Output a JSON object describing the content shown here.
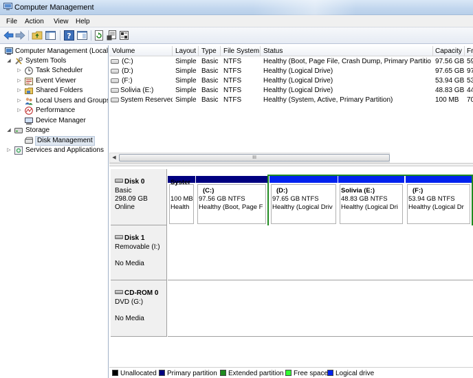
{
  "window": {
    "title": "Computer Management"
  },
  "menu": [
    "File",
    "Action",
    "View",
    "Help"
  ],
  "toolbar": {
    "buttons": [
      "back-arrow-icon",
      "forward-arrow-icon",
      "up-folder-icon",
      "show-hide-console-tree-icon",
      "help-icon",
      "properties-icon",
      "refresh-icon",
      "export-list-icon",
      "settings-icon"
    ]
  },
  "tree": [
    {
      "label": "Computer Management (Local",
      "name": "tree-computer-management",
      "icon": "computer-icon",
      "exp": "",
      "selected": false
    },
    {
      "label": "System Tools",
      "name": "tree-system-tools",
      "icon": "tools-icon",
      "exp": "◢",
      "selected": false
    },
    {
      "label": "Task Scheduler",
      "name": "tree-task-scheduler",
      "icon": "clock-icon",
      "exp": "▷",
      "selected": false
    },
    {
      "label": "Event Viewer",
      "name": "tree-event-viewer",
      "icon": "event-viewer-icon",
      "exp": "▷",
      "selected": false
    },
    {
      "label": "Shared Folders",
      "name": "tree-shared-folders",
      "icon": "shared-folder-icon",
      "exp": "▷",
      "selected": false
    },
    {
      "label": "Local Users and Groups",
      "name": "tree-local-users",
      "icon": "users-icon",
      "exp": "▷",
      "selected": false
    },
    {
      "label": "Performance",
      "name": "tree-performance",
      "icon": "performance-icon",
      "exp": "▷",
      "selected": false
    },
    {
      "label": "Device Manager",
      "name": "tree-device-manager",
      "icon": "device-manager-icon",
      "exp": "",
      "selected": false
    },
    {
      "label": "Storage",
      "name": "tree-storage",
      "icon": "storage-icon",
      "exp": "◢",
      "selected": false
    },
    {
      "label": "Disk Management",
      "name": "tree-disk-management",
      "icon": "disk-icon",
      "exp": "",
      "selected": true
    },
    {
      "label": "Services and Applications",
      "name": "tree-services-applications",
      "icon": "services-icon",
      "exp": "▷",
      "selected": false
    }
  ],
  "columns": [
    "Volume",
    "Layout",
    "Type",
    "File System",
    "Status",
    "Capacity",
    "Fr"
  ],
  "volumes": [
    [
      "(C:)",
      "Simple",
      "Basic",
      "NTFS",
      "Healthy (Boot, Page File, Crash Dump, Primary Partition)",
      "97.56 GB",
      "59"
    ],
    [
      "(D:)",
      "Simple",
      "Basic",
      "NTFS",
      "Healthy (Logical Drive)",
      "97.65 GB",
      "97"
    ],
    [
      "(F:)",
      "Simple",
      "Basic",
      "NTFS",
      "Healthy (Logical Drive)",
      "53.94 GB",
      "53"
    ],
    [
      "Solivia (E:)",
      "Simple",
      "Basic",
      "NTFS",
      "Healthy (Logical Drive)",
      "48.83 GB",
      "44"
    ],
    [
      "System Reserved",
      "Simple",
      "Basic",
      "NTFS",
      "Healthy (System, Active, Primary Partition)",
      "100 MB",
      "70"
    ]
  ],
  "scrollbar": {
    "grip": "III"
  },
  "disks": [
    {
      "name": "Disk 0",
      "lines": [
        "Basic",
        "298.09 GB",
        "Online"
      ],
      "partitions": [
        {
          "label": "Syster",
          "size": "100 MB",
          "status": "Health",
          "kind": "primary"
        },
        {
          "label": "(C:)",
          "size": "97.56 GB NTFS",
          "status": "Healthy (Boot, Page F",
          "kind": "primary"
        },
        {
          "label": "(D:)",
          "size": "97.65 GB NTFS",
          "status": "Healthy (Logical Driv",
          "kind": "logical"
        },
        {
          "label": "Solivia  (E:)",
          "size": "48.83 GB NTFS",
          "status": "Healthy (Logical Dri",
          "kind": "logical"
        },
        {
          "label": "(F:)",
          "size": "53.94 GB NTFS",
          "status": "Healthy (Logical Dr",
          "kind": "logical"
        }
      ]
    },
    {
      "name": "Disk 1",
      "lines": [
        "Removable (I:)",
        "",
        "No Media"
      ],
      "partitions": []
    },
    {
      "name": "CD-ROM 0",
      "lines": [
        "DVD (G:)",
        "",
        "No Media"
      ],
      "partitions": []
    }
  ],
  "legend": [
    {
      "label": "Unallocated",
      "color": "#000000"
    },
    {
      "label": "Primary partition",
      "color": "#000080"
    },
    {
      "label": "Extended partition",
      "color": "#1f8a1f"
    },
    {
      "label": "Free space",
      "color": "#33ff33"
    },
    {
      "label": "Logical drive",
      "color": "#0022ee"
    }
  ],
  "colors": {
    "primary": "#000080",
    "logical": "#0022ee",
    "extended": "#1f8a1f"
  }
}
